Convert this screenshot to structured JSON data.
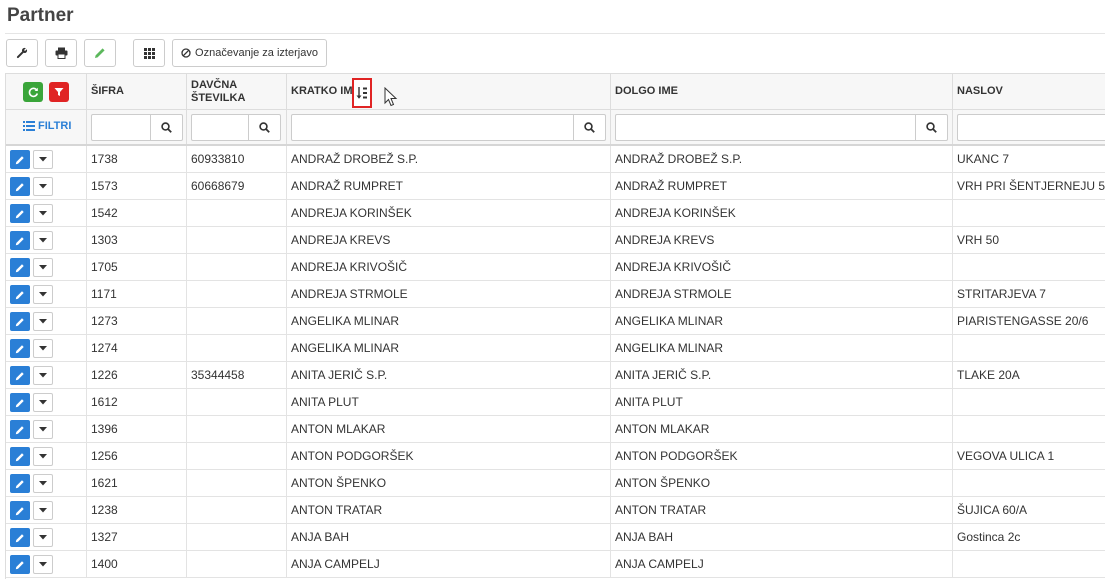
{
  "page": {
    "title": "Partner"
  },
  "toolbar": {
    "mark_label": "Označevanje za izterjavo"
  },
  "filters": {
    "label": "FILTRI"
  },
  "columns": [
    {
      "key": "sifra",
      "label": "ŠIFRA"
    },
    {
      "key": "davcna",
      "label": "DAVČNA\nŠTEVILKA"
    },
    {
      "key": "kratko",
      "label": "KRATKO IME"
    },
    {
      "key": "dolgo",
      "label": "DOLGO IME"
    },
    {
      "key": "naslov",
      "label": "NASLOV"
    }
  ],
  "rows": [
    {
      "sifra": "1738",
      "davcna": "60933810",
      "kratko": "ANDRAŽ DROBEŽ S.P.",
      "dolgo": "ANDRAŽ DROBEŽ S.P.",
      "naslov": "UKANC 7"
    },
    {
      "sifra": "1573",
      "davcna": "60668679",
      "kratko": "ANDRAŽ RUMPRET",
      "dolgo": "ANDRAŽ RUMPRET",
      "naslov": "VRH PRI ŠENTJERNEJU 5"
    },
    {
      "sifra": "1542",
      "davcna": "",
      "kratko": "ANDREJA KORINŠEK",
      "dolgo": "ANDREJA KORINŠEK",
      "naslov": ""
    },
    {
      "sifra": "1303",
      "davcna": "",
      "kratko": "ANDREJA KREVS",
      "dolgo": "ANDREJA KREVS",
      "naslov": "VRH 50"
    },
    {
      "sifra": "1705",
      "davcna": "",
      "kratko": "ANDREJA KRIVOŠIČ",
      "dolgo": "ANDREJA KRIVOŠIČ",
      "naslov": ""
    },
    {
      "sifra": "1171",
      "davcna": "",
      "kratko": "ANDREJA STRMOLE",
      "dolgo": "ANDREJA STRMOLE",
      "naslov": "STRITARJEVA 7"
    },
    {
      "sifra": "1273",
      "davcna": "",
      "kratko": "ANGELIKA MLINAR",
      "dolgo": "ANGELIKA MLINAR",
      "naslov": "PIARISTENGASSE 20/6"
    },
    {
      "sifra": "1274",
      "davcna": "",
      "kratko": "ANGELIKA MLINAR",
      "dolgo": "ANGELIKA MLINAR",
      "naslov": ""
    },
    {
      "sifra": "1226",
      "davcna": "35344458",
      "kratko": "ANITA JERIČ S.P.",
      "dolgo": "ANITA JERIČ S.P.",
      "naslov": "TLAKE 20A"
    },
    {
      "sifra": "1612",
      "davcna": "",
      "kratko": "ANITA PLUT",
      "dolgo": "ANITA PLUT",
      "naslov": ""
    },
    {
      "sifra": "1396",
      "davcna": "",
      "kratko": "ANTON MLAKAR",
      "dolgo": "ANTON MLAKAR",
      "naslov": ""
    },
    {
      "sifra": "1256",
      "davcna": "",
      "kratko": "ANTON PODGORŠEK",
      "dolgo": "ANTON PODGORŠEK",
      "naslov": "VEGOVA ULICA 1"
    },
    {
      "sifra": "1621",
      "davcna": "",
      "kratko": "ANTON ŠPENKO",
      "dolgo": "ANTON ŠPENKO",
      "naslov": ""
    },
    {
      "sifra": "1238",
      "davcna": "",
      "kratko": "ANTON TRATAR",
      "dolgo": "ANTON TRATAR",
      "naslov": "ŠUJICA 60/A"
    },
    {
      "sifra": "1327",
      "davcna": "",
      "kratko": "ANJA BAH",
      "dolgo": "ANJA BAH",
      "naslov": "Gostinca 2c"
    },
    {
      "sifra": "1400",
      "davcna": "",
      "kratko": "ANJA CAMPELJ",
      "dolgo": "ANJA CAMPELJ",
      "naslov": ""
    }
  ],
  "colors": {
    "accent": "#2a7fd6",
    "refresh": "#3aa53a",
    "filter": "#e02424",
    "sort_highlight": "#e02424"
  },
  "icons": {
    "toolbar": [
      "wrench-icon",
      "print-icon",
      "pencil-icon",
      "grid-icon",
      "ban-icon"
    ],
    "filter_search": "search-icon",
    "row_actions": [
      "pencil-icon",
      "caret-down-icon"
    ]
  }
}
